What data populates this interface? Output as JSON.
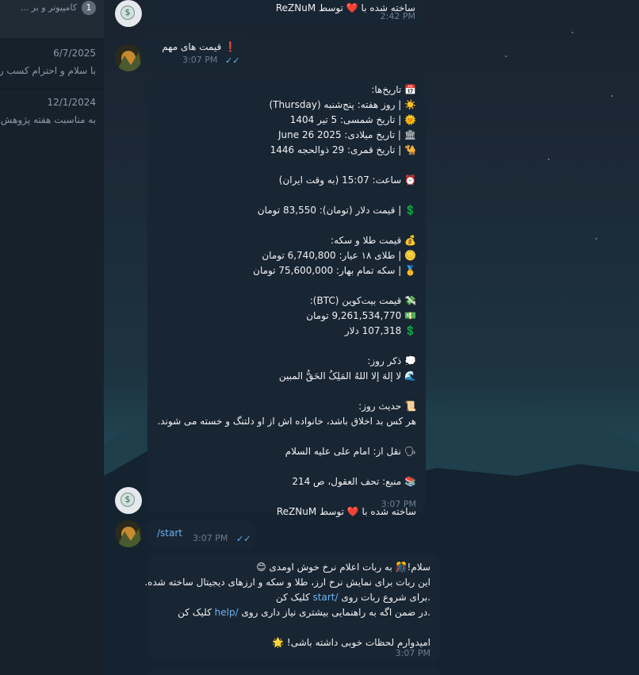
{
  "sidebar": {
    "top_chat": {
      "badge": "1",
      "preview": "کامپیوتر و بر ..."
    },
    "chats": [
      {
        "date": "6/7/2025",
        "preview": "با سلام و احترام  کسب ر"
      },
      {
        "date": "12/1/2024",
        "preview": "به مناسبت هفته پژوهش"
      }
    ]
  },
  "messages": {
    "m1": {
      "text": "ساخته شده با ❤️ توسط ReZNuM",
      "time": "2:42 PM"
    },
    "m2": {
      "icon": "❗",
      "text": "قیمت های مهم",
      "time": "3:07 PM"
    },
    "m3": {
      "lines": [
        "📅 تاریخ‌ها:",
        "☀️ | روز هفته: پنج‌شنبه (Thursday)",
        "🌞 | تاریخ شمسی: 5 تیر 1404",
        "🏛 | تاریخ میلادی: June 26 2025",
        "🐪 | تاریخ قمری: 29 ذوالحجه 1446",
        "",
        "⏰ ساعت: 15:07 (به وقت ایران)",
        "",
        "💲 | قیمت دلار (تومان): 83,550 تومان",
        "",
        "💰 قیمت طلا و سکه:",
        "🪙 | طلای ۱۸ عیار: 6,740,800 تومان",
        "🥇 | سکه تمام بهار: 75,600,000 تومان",
        "",
        "💸 قیمت بیت‌کوین (BTC):",
        "💵 9,261,534,770 تومان",
        "💲 107,318 دلار",
        "",
        "💭 ذکر روز:",
        "🌊 لا إلهَ إلا اللهُ المَلِکُ الحَقُّ المبین",
        "",
        "📜 حدیث روز:",
        "هر کس بد اخلاق باشد، خانواده اش از او دلتنگ و خسته می شوند.",
        "",
        "🗣 نقل از: امام علی  علیه  السلام",
        "",
        "📚 منبع: تحف العقول، ص 214",
        "",
        "ساخته شده با ❤️ توسط ReZNuM"
      ],
      "time": "3:07 PM"
    },
    "m4": {
      "text": "/start",
      "time": "3:07 PM"
    },
    "m5": {
      "line1": "سلام!🎊 به ربات اعلام نرخ خوش اومدی 😊",
      "line2": "این ربات برای نمایش نرخ ارز، طلا و سکه و ارزهای دیجیتال ساخته شده.",
      "line3_a": ".برای شروع ربات روی ",
      "line3_link": "/start",
      "line3_b": " کلیک کن",
      "line4_a": ".در ضمن اگه به راهنمایی بیشتری نیاز داری روی ",
      "line4_link": "/help",
      "line4_b": " کلیک کن",
      "line6": "امیدوارم لحظات خوبی داشته باشی! 🌟",
      "time": "3:07 PM"
    }
  },
  "colors": {
    "accent": "#6ab3f3",
    "incoming": "#182533",
    "outgoing": "#2b5278"
  }
}
